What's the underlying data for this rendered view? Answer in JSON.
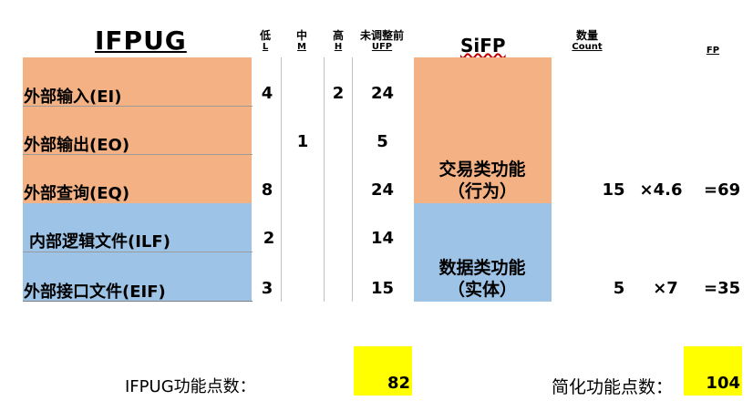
{
  "header": {
    "ifpug": "IFPUG",
    "low": "低",
    "low_sub": "L",
    "mid": "中",
    "mid_sub": "M",
    "high": "高",
    "high_sub": "H",
    "ufp": "未调整前",
    "ufp_sub": "UFP",
    "sifp": "SiFP",
    "count": "数量",
    "count_sub": "Count",
    "fp_sub": "FP"
  },
  "rows": [
    {
      "label": "外部输入(EI)",
      "low": "4",
      "mid": "",
      "high": "2",
      "ufp": "24"
    },
    {
      "label": "外部输出(EO)",
      "low": "",
      "mid": "1",
      "high": "",
      "ufp": "5"
    },
    {
      "label": "外部查询(EQ)",
      "low": "8",
      "mid": "",
      "high": "",
      "ufp": "24"
    },
    {
      "label": "内部逻辑文件(ILF)",
      "low": "2",
      "mid": "",
      "high": "",
      "ufp": "14"
    },
    {
      "label": "外部接口文件(EIF)",
      "low": "3",
      "mid": "",
      "high": "",
      "ufp": "15"
    }
  ],
  "sifp_groups": [
    {
      "line1": "交易类功能",
      "line2": "（行为）",
      "count": "15",
      "factor": "×4.6",
      "fp": "=69"
    },
    {
      "line1": "数据类功能",
      "line2": "（实体）",
      "count": "5",
      "factor": "×7",
      "fp": "=35"
    }
  ],
  "totals": {
    "ifpug_label": "IFPUG功能点数：",
    "ifpug_value": "82",
    "sifp_label": "简化功能点数：",
    "sifp_value": "104"
  },
  "colors": {
    "orange": "#f4b183",
    "blue": "#9dc3e6",
    "yellow": "#ffff00"
  }
}
